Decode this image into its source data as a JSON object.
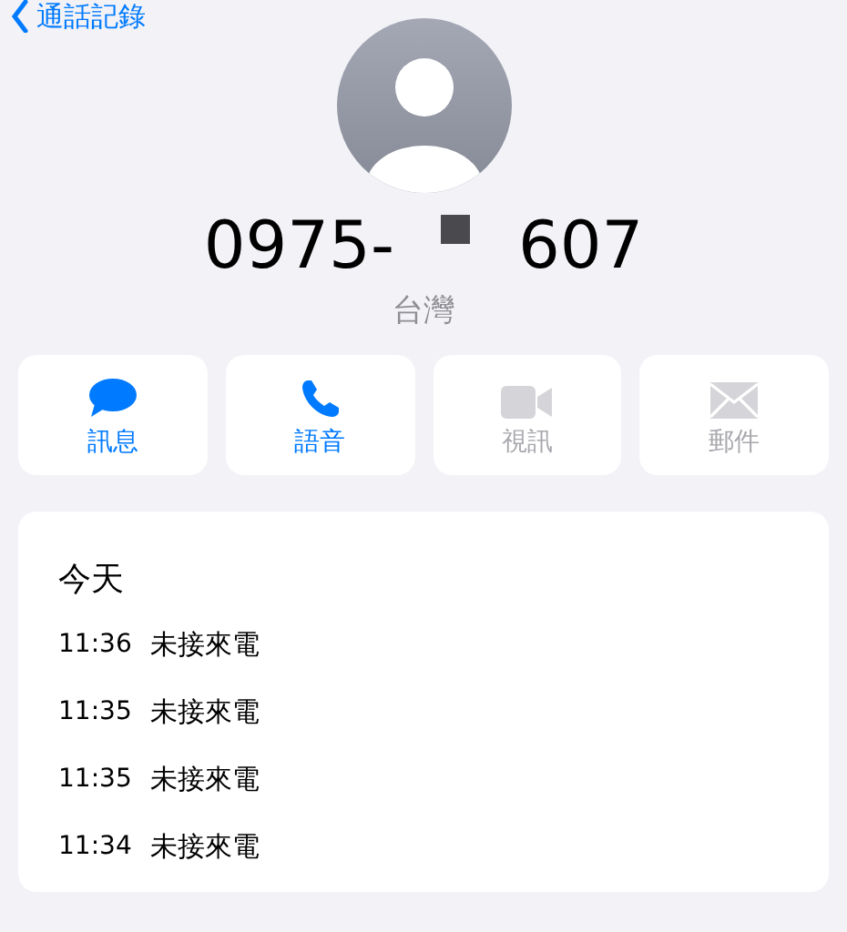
{
  "nav": {
    "back_label": "通話記錄"
  },
  "contact": {
    "number_prefix": "0975-",
    "number_redacted": true,
    "number_suffix": "607",
    "region": "台灣"
  },
  "actions": [
    {
      "kind": "message",
      "label": "訊息",
      "disabled": false
    },
    {
      "kind": "phone",
      "label": "語音",
      "disabled": false
    },
    {
      "kind": "video",
      "label": "視訊",
      "disabled": true
    },
    {
      "kind": "mail",
      "label": "郵件",
      "disabled": true
    }
  ],
  "history": {
    "heading": "今天",
    "calls": [
      {
        "time": "11:36",
        "type": "未接來電"
      },
      {
        "time": "11:35",
        "type": "未接來電"
      },
      {
        "time": "11:35",
        "type": "未接來電"
      },
      {
        "time": "11:34",
        "type": "未接來電"
      }
    ]
  }
}
